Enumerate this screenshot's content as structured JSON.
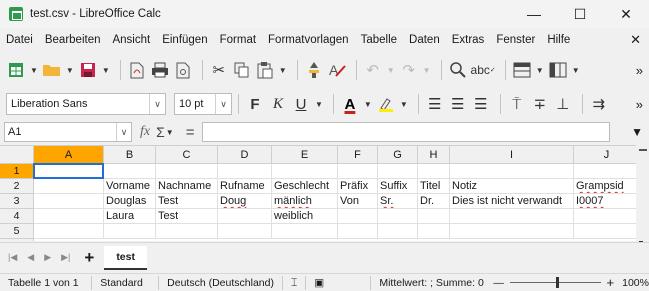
{
  "window": {
    "title": "test.csv - LibreOffice Calc",
    "minimize": "—",
    "maximize": "☐",
    "close": "✕"
  },
  "menu": {
    "items": [
      "Datei",
      "Bearbeiten",
      "Ansicht",
      "Einfügen",
      "Format",
      "Formatvorlagen",
      "Tabelle",
      "Daten",
      "Extras",
      "Fenster",
      "Hilfe"
    ],
    "close_doc": "✕"
  },
  "toolbar1": {
    "icons": [
      "new-spreadsheet-icon",
      "open-folder-icon",
      "save-icon",
      "export-pdf-icon",
      "print-icon",
      "print-preview-icon",
      "cut-icon",
      "copy-icon",
      "paste-icon",
      "clone-formatting-icon",
      "clear-formatting-icon",
      "undo-icon",
      "redo-icon",
      "find-replace-icon",
      "spellcheck-icon",
      "rows-icon",
      "columns-icon"
    ],
    "more": "»"
  },
  "toolbar2": {
    "font_name": "Liberation Sans",
    "font_size": "10 pt",
    "bold": "F",
    "italic": "K",
    "underline": "U",
    "font_color": "A",
    "highlight": "ꝛ",
    "more": "»"
  },
  "formula": {
    "cell_ref": "A1",
    "fx": "fx",
    "sigma": "Σ",
    "equals": "=",
    "value": ""
  },
  "grid": {
    "columns": [
      "A",
      "B",
      "C",
      "D",
      "E",
      "F",
      "G",
      "H",
      "I",
      "J"
    ],
    "rows": [
      "1",
      "2",
      "3",
      "4",
      "5"
    ],
    "cells": [
      [
        "",
        "",
        "",
        "",
        "",
        "",
        "",
        "",
        "",
        ""
      ],
      [
        "",
        "Vorname",
        "Nachname",
        "Rufname",
        "Geschlecht",
        "Präfix",
        "Suffix",
        "Titel",
        "Notiz",
        "Grampsid"
      ],
      [
        "",
        "Douglas",
        "Test",
        "Doug",
        "mänlich",
        "Von",
        "Sr.",
        "Dr.",
        "Dies ist nicht verwandt",
        "I0007"
      ],
      [
        "",
        "Laura",
        "Test",
        "",
        "weiblich",
        "",
        "",
        "",
        "",
        ""
      ],
      [
        "",
        "",
        "",
        "",
        "",
        "",
        "",
        "",
        "",
        ""
      ]
    ],
    "selected_cell": "A1"
  },
  "sheet_tabs": {
    "add": "+",
    "tabs": [
      "test"
    ]
  },
  "status": {
    "sheet": "Tabelle 1 von 1",
    "style": "Standard",
    "language": "Deutsch (Deutschland)",
    "summary": "Mittelwert: ; Summe: 0",
    "zoom_minus": "—",
    "zoom_plus": "+",
    "zoom": "100%",
    "zoom_level": 1.0
  }
}
